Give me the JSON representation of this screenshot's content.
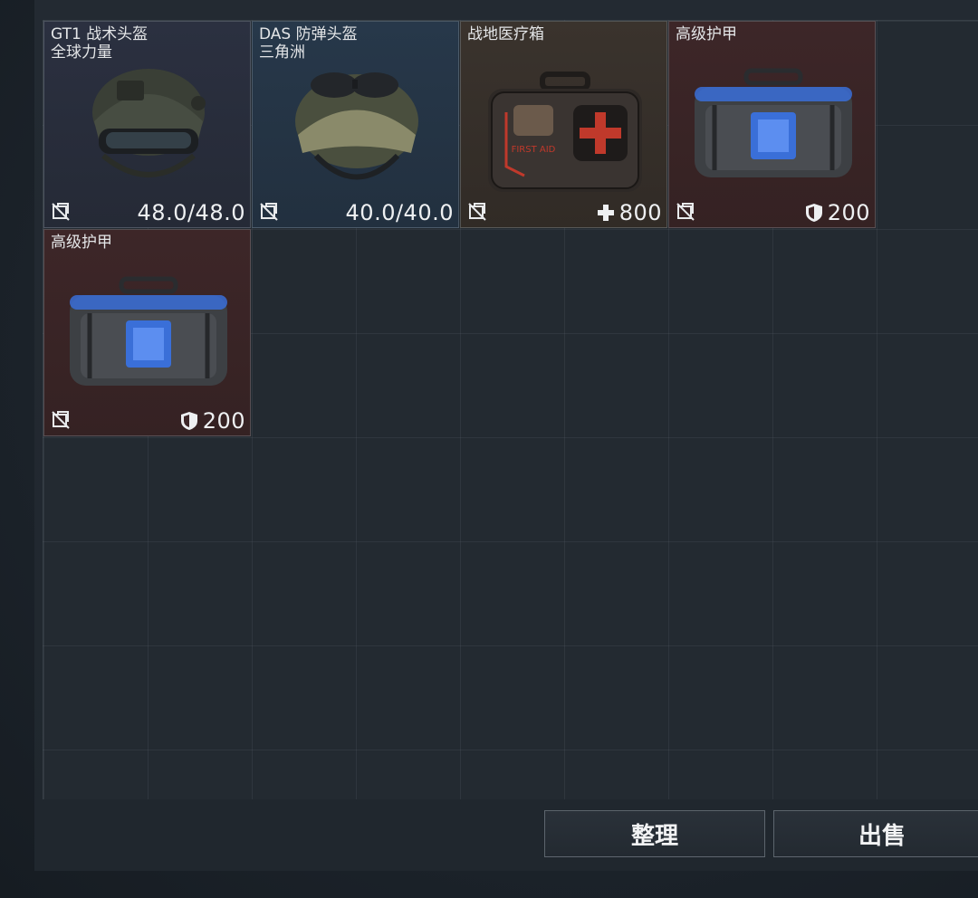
{
  "inventory": {
    "items": [
      {
        "name": "GT1 战术头盔",
        "sub": "全球力量",
        "stat": "48.0/48.0",
        "stat_icon": "none",
        "color": "dark-navy",
        "art": "tactical-helmet-icon"
      },
      {
        "name": "DAS 防弹头盔",
        "sub": "三角洲",
        "stat": "40.0/40.0",
        "stat_icon": "none",
        "color": "steel-blue",
        "art": "ballistic-helmet-icon"
      },
      {
        "name": "战地医疗箱",
        "sub": "",
        "stat": "800",
        "stat_icon": "plus-icon",
        "color": "brown",
        "art": "first-aid-kit-icon",
        "art_text": "FIRST AID"
      },
      {
        "name": "高级护甲",
        "sub": "",
        "stat": "200",
        "stat_icon": "shield-icon",
        "color": "dark-red",
        "art": "armor-bag-icon"
      },
      {
        "name": "高级护甲",
        "sub": "",
        "stat": "200",
        "stat_icon": "shield-icon",
        "color": "dark-red",
        "art": "armor-bag-icon"
      }
    ]
  },
  "actions": {
    "organize_label": "整理",
    "sell_label": "出售"
  },
  "colors": {
    "accent_red": "#c0392b",
    "armor_blue": "#3a6fd8",
    "text": "#e4e6e8"
  }
}
